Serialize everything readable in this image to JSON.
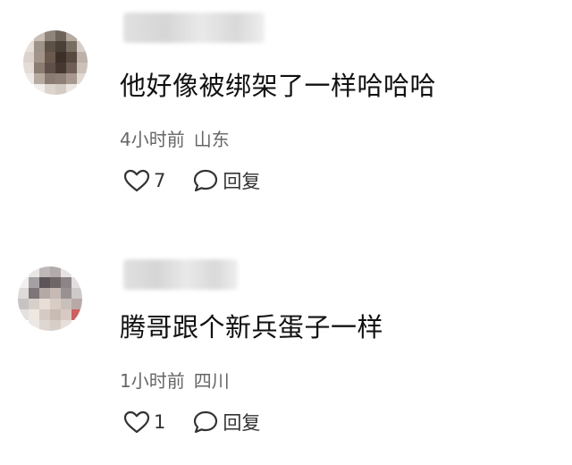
{
  "comments": [
    {
      "text": "他好像被绑架了一样哈哈哈",
      "time": "4小时前",
      "location": "山东",
      "likes": "7",
      "reply_label": "回复",
      "avatar_colors": [
        "#f0ecea",
        "#c9bfb6",
        "#8f857a",
        "#6d6359",
        "#b5aaa0",
        "#efeae6",
        "#e7e0da",
        "#9e9388",
        "#5d5247",
        "#4a4037",
        "#7a6e63",
        "#d6cec7",
        "#dcd3cc",
        "#a3948a",
        "#6a5a4e",
        "#3c3129",
        "#58493f",
        "#bdb1a8",
        "#e4ddd7",
        "#8c7d72",
        "#60504a",
        "#453832",
        "#6e5e55",
        "#cbc1b9",
        "#efe9e5",
        "#b6aaa1",
        "#8a7b72",
        "#8e7f77",
        "#a6988f",
        "#e1dad4",
        "#ffffff",
        "#f2eeeb",
        "#dcd4ce",
        "#d4cbc4",
        "#ebe6e2",
        "#ffffff"
      ]
    },
    {
      "text": "腾哥跟个新兵蛋子一样",
      "time": "1小时前",
      "location": "四川",
      "likes": "1",
      "reply_label": "回复",
      "avatar_colors": [
        "#ffffff",
        "#e9e6e6",
        "#bdb7b8",
        "#b3abab",
        "#e7e3e3",
        "#ffffff",
        "#f1efef",
        "#a5a0a3",
        "#5c5557",
        "#6f6666",
        "#8c8486",
        "#e2dede",
        "#dedada",
        "#7d7678",
        "#b5a9a6",
        "#c7bab5",
        "#9a9192",
        "#cfcaca",
        "#c8c3c3",
        "#d9cfca",
        "#e8ddd7",
        "#d8ccc5",
        "#c9bfbb",
        "#b8a9a7",
        "#e5e1df",
        "#efe7e2",
        "#d6cbc4",
        "#c9bcb4",
        "#d9c9c4",
        "#cc5f5f",
        "#ffffff",
        "#ede8e5",
        "#ded6d0",
        "#d7cec8",
        "#e6dfdb",
        "#ffffff"
      ]
    }
  ]
}
